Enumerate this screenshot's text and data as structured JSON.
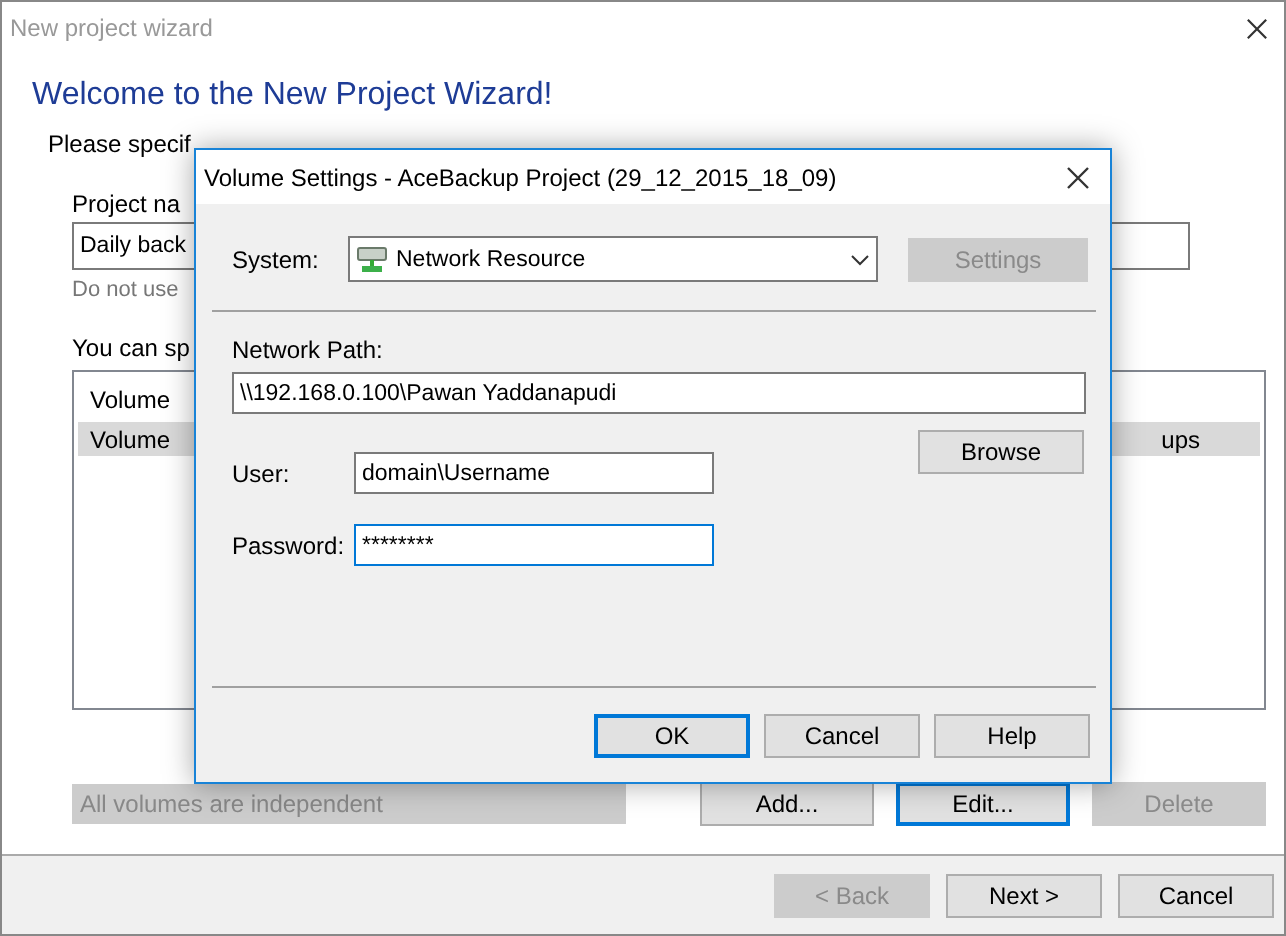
{
  "wizard": {
    "title": "New project wizard",
    "heading": "Welcome to the New Project Wizard!",
    "intro": "Please specif",
    "project_name_label": "Project na",
    "project_name_value": "Daily back",
    "hint": "Do not use",
    "volumes_label": "You can sp",
    "volume_list": {
      "columns": [
        "Volume"
      ],
      "rows": [
        {
          "cells": [
            "Volume",
            "ups"
          ],
          "selected": true
        }
      ]
    },
    "dependency": {
      "value": "All volumes are independent",
      "disabled": true
    },
    "list_buttons": [
      {
        "label": "Add...",
        "disabled": false,
        "focused": false
      },
      {
        "label": "Edit...",
        "disabled": false,
        "focused": true
      },
      {
        "label": "Delete",
        "disabled": true,
        "focused": false
      }
    ],
    "nav_buttons": [
      {
        "label": "< Back",
        "disabled": true,
        "focused": false
      },
      {
        "label": "Next >",
        "disabled": false,
        "focused": false
      },
      {
        "label": "Cancel",
        "disabled": false,
        "focused": false
      }
    ]
  },
  "dialog": {
    "title": "Volume Settings - AceBackup Project (29_12_2015_18_09)",
    "system_label": "System:",
    "system_value": "Network Resource",
    "settings_button": {
      "label": "Settings",
      "disabled": true,
      "focused": false
    },
    "path_label": "Network Path:",
    "path_value": "\\\\192.168.0.100\\Pawan Yaddanapudi",
    "browse_button": {
      "label": "Browse",
      "disabled": false,
      "focused": false
    },
    "user_label": "User:",
    "user_value": "domain\\Username",
    "password_label": "Password:",
    "password_value": "********",
    "password_focused": true,
    "buttons": [
      {
        "label": "OK",
        "disabled": false,
        "focused": true
      },
      {
        "label": "Cancel",
        "disabled": false,
        "focused": false
      },
      {
        "label": "Help",
        "disabled": false,
        "focused": false
      }
    ]
  }
}
